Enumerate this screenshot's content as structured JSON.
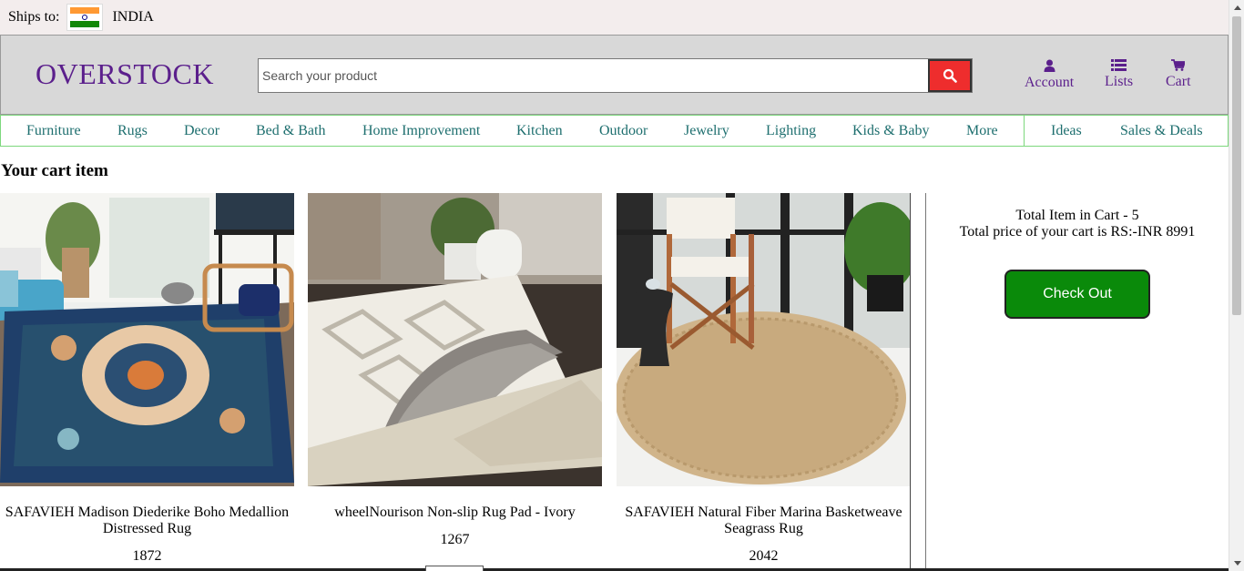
{
  "shipbar": {
    "label": "Ships to:",
    "country": "INDIA",
    "flag_icon": "india-flag-icon"
  },
  "header": {
    "logo": "OVERSTOCK",
    "search_placeholder": "Search your product",
    "search_icon": "search-icon",
    "account_label": "Account",
    "lists_label": "Lists",
    "cart_label": "Cart"
  },
  "nav": {
    "items": [
      "Furniture",
      "Rugs",
      "Decor",
      "Bed & Bath",
      "Home Improvement",
      "Kitchen",
      "Outdoor",
      "Jewelry",
      "Lighting",
      "Kids & Baby",
      "More"
    ],
    "right_items": [
      "Ideas",
      "Sales & Deals"
    ]
  },
  "cart": {
    "title": "Your cart item",
    "products": [
      {
        "name": "SAFAVIEH Madison Diederike Boho Medallion Distressed Rug",
        "price": "1872"
      },
      {
        "name": "wheelNourison Non-slip Rug Pad - Ivory",
        "price": "1267"
      },
      {
        "name": "SAFAVIEH Natural Fiber Marina Basketweave Seagrass Rug",
        "price": "2042"
      }
    ]
  },
  "summary": {
    "total_items": "Total Item in Cart - 5",
    "total_price": "Total price of your cart is RS:-INR 8991",
    "checkout_label": "Check Out"
  },
  "colors": {
    "brand": "#5b1f8c",
    "nav_text": "#1e6f6f",
    "nav_border": "#7dd87d",
    "search_button": "#ee2d2d",
    "checkout": "#0a8a0a"
  }
}
